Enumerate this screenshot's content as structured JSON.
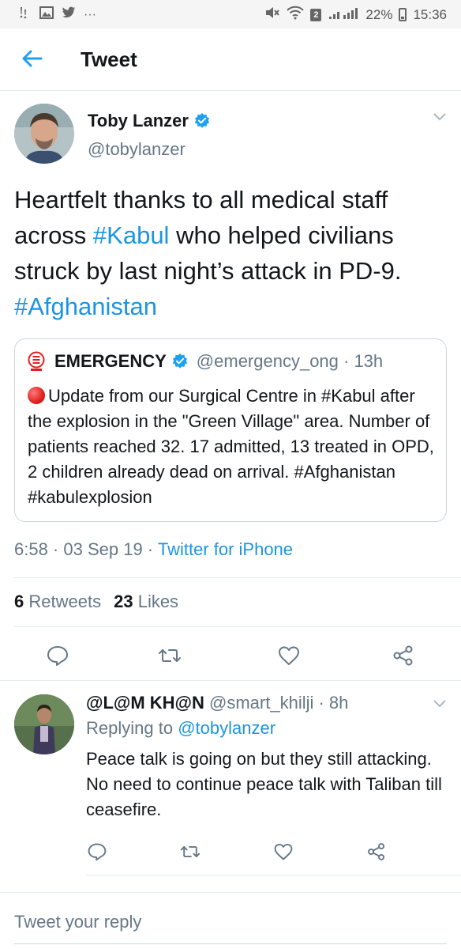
{
  "status_bar": {
    "left_icons": [
      "alert-icon",
      "image-icon",
      "twitter-icon",
      "more-icon"
    ],
    "more": "···",
    "sim": "2",
    "battery": "22%",
    "time": "15:36"
  },
  "header": {
    "title": "Tweet"
  },
  "tweet": {
    "author_name": "Toby Lanzer",
    "author_handle": "@tobylanzer",
    "text_parts": {
      "p1": "Heartfelt thanks to all medical staff across ",
      "h1": "#Kabul",
      "p2": " who helped civilians struck by last night’s attack in PD-9. ",
      "h2": "#Afghanistan"
    },
    "quote": {
      "name": "EMERGENCY",
      "handle": "@emergency_ong · 13h",
      "text": "Update from our Surgical Centre in #Kabul after the explosion in the \"Green Village\" area. Number of patients reached 32. 17 admitted, 13 treated in OPD, 2 children already dead on arrival. #Afghanistan #kabulexplosion"
    },
    "time_date": "6:58 · 03 Sep 19 · ",
    "source": "Twitter for iPhone",
    "retweets_count": "6",
    "retweets_label": "Retweets",
    "likes_count": "23",
    "likes_label": "Likes"
  },
  "reply": {
    "name": "@L@M KH@N",
    "handle": " @smart_khilji · 8h",
    "replying_prefix": "Replying to ",
    "replying_to": "@tobylanzer",
    "text": "Peace talk is going on but they still attacking. No need to continue peace talk with Taliban till ceasefire."
  },
  "compose": {
    "placeholder": "Tweet your reply"
  },
  "colors": {
    "link": "#1b95e0",
    "verified": "#1da1f2",
    "muted": "#657786",
    "emergency_red": "#e0201e"
  }
}
